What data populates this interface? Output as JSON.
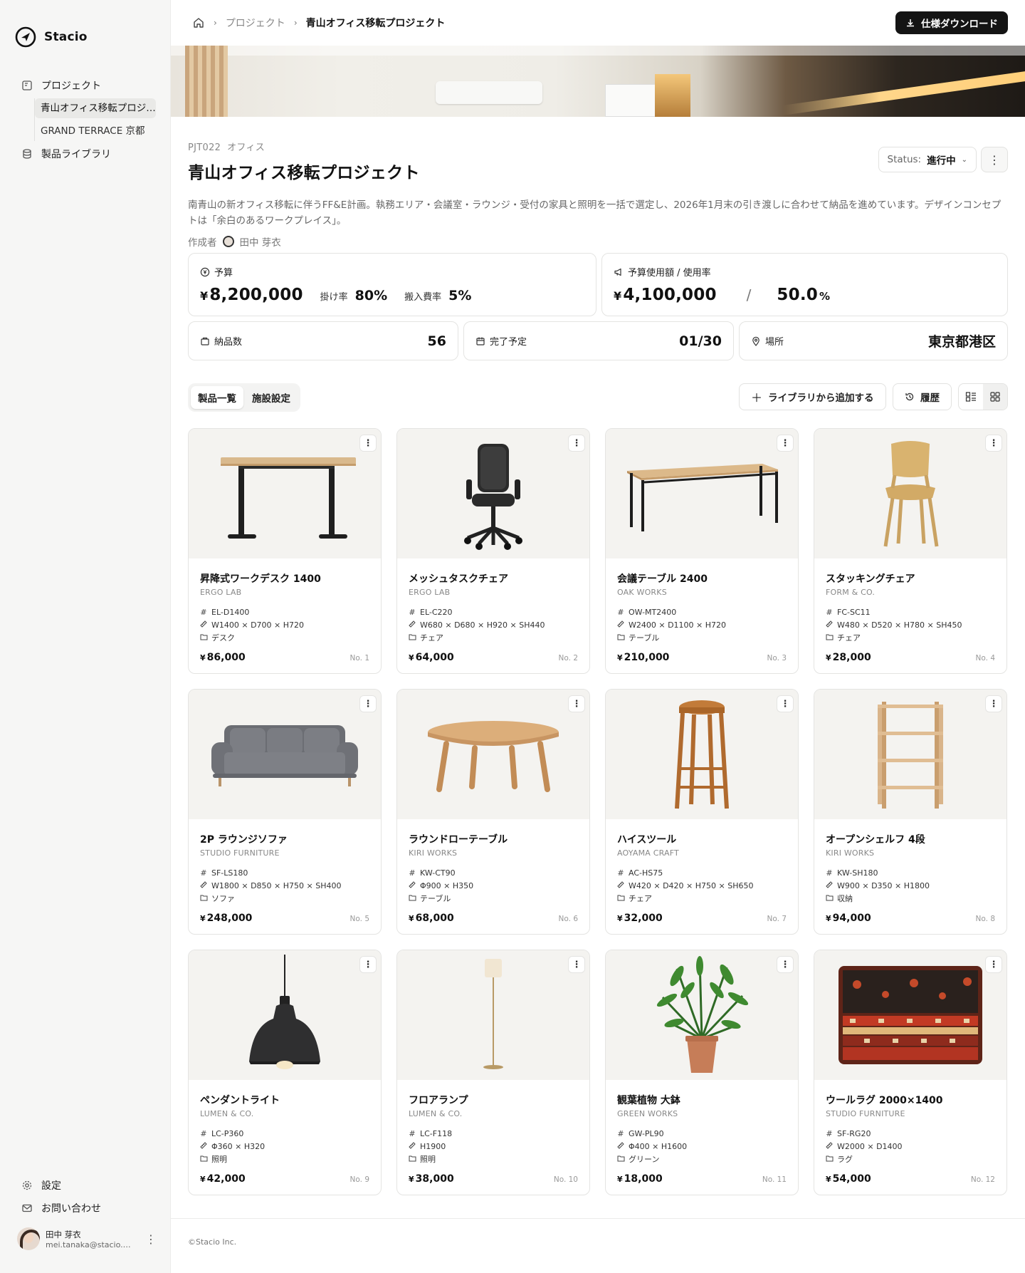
{
  "app": {
    "name": "Stacio"
  },
  "sidebar": {
    "nav": [
      {
        "label": "プロジェクト",
        "icon": "project-icon"
      },
      {
        "label": "製品ライブラリ",
        "icon": "database-icon"
      }
    ],
    "projects": [
      {
        "label": "青山オフィス移転プロジェクト",
        "active": true
      },
      {
        "label": "GRAND TERRACE 京都",
        "active": false
      }
    ],
    "bottom": [
      {
        "label": "設定",
        "icon": "gear-icon"
      },
      {
        "label": "お問い合わせ",
        "icon": "mail-icon"
      }
    ],
    "user": {
      "name": "田中 芽衣",
      "email": "mei.tanaka@stacio.co.jp"
    }
  },
  "breadcrumb": {
    "items": [
      "プロジェクト",
      "青山オフィス移転プロジェクト"
    ]
  },
  "header": {
    "download_label": "仕様ダウンロード"
  },
  "project": {
    "code": "PJT022",
    "type": "オフィス",
    "title": "青山オフィス移転プロジェクト",
    "status_label": "Status:",
    "status_value": "進行中",
    "description": "南青山の新オフィス移転に伴うFF&E計画。執務エリア・会議室・ラウンジ・受付の家具と照明を一括で選定し、2026年1月末の引き渡しに合わせて納品を進めています。デザインコンセプトは「余白のあるワークプレイス」。",
    "author_label": "作成者",
    "author_name": "田中 芽衣"
  },
  "stats": {
    "budget": {
      "label": "予算",
      "currency": "¥",
      "value": "8,200,000",
      "rate_label": "掛け率",
      "rate": "80%",
      "delivery_label": "搬入費率",
      "delivery": "5%"
    },
    "usage": {
      "label": "予算使用額 / 使用率",
      "currency": "¥",
      "value": "4,100,000",
      "separator": "/",
      "rate": "50.0",
      "unit": "%"
    },
    "items": {
      "label": "納品数",
      "value": "56"
    },
    "due": {
      "label": "完了予定",
      "value": "01/30"
    },
    "location": {
      "label": "場所",
      "value": "東京都港区"
    }
  },
  "toolbar": {
    "tabs": [
      "製品一覧",
      "施設設定"
    ],
    "add_label": "ライブラリから追加する",
    "history_label": "履歴"
  },
  "products": [
    {
      "name": "昇降式ワークデスク 1400",
      "brand": "ERGO LAB",
      "code": "EL-D1400",
      "size": "W1400 × D700 × H720",
      "category": "デスク",
      "price": "86,000",
      "no": "No. 1",
      "image": "desk"
    },
    {
      "name": "メッシュタスクチェア",
      "brand": "ERGO LAB",
      "code": "EL-C220",
      "size": "W680 × D680 × H920 × SH440",
      "category": "チェア",
      "price": "64,000",
      "no": "No. 2",
      "image": "taskchair"
    },
    {
      "name": "会議テーブル 2400",
      "brand": "OAK WORKS",
      "code": "OW-MT2400",
      "size": "W2400 × D1100 × H720",
      "category": "テーブル",
      "price": "210,000",
      "no": "No. 3",
      "image": "table"
    },
    {
      "name": "スタッキングチェア",
      "brand": "FORM & CO.",
      "code": "FC-SC11",
      "size": "W480 × D520 × H780 × SH450",
      "category": "チェア",
      "price": "28,000",
      "no": "No. 4",
      "image": "woodchair"
    },
    {
      "name": "2P ラウンジソファ",
      "brand": "STUDIO FURNITURE",
      "code": "SF-LS180",
      "size": "W1800 × D850 × H750 × SH400",
      "category": "ソファ",
      "price": "248,000",
      "no": "No. 5",
      "image": "sofa"
    },
    {
      "name": "ラウンドローテーブル",
      "brand": "KIRI WORKS",
      "code": "KW-CT90",
      "size": "Φ900 × H350",
      "category": "テーブル",
      "price": "68,000",
      "no": "No. 6",
      "image": "roundtable"
    },
    {
      "name": "ハイスツール",
      "brand": "AOYAMA CRAFT",
      "code": "AC-HS75",
      "size": "W420 × D420 × H750 × SH650",
      "category": "チェア",
      "price": "32,000",
      "no": "No. 7",
      "image": "stool"
    },
    {
      "name": "オープンシェルフ 4段",
      "brand": "KIRI WORKS",
      "code": "KW-SH180",
      "size": "W900 × D350 × H1800",
      "category": "収納",
      "price": "94,000",
      "no": "No. 8",
      "image": "shelf"
    },
    {
      "name": "ペンダントライト",
      "brand": "LUMEN & CO.",
      "code": "LC-P360",
      "size": "Φ360 × H320",
      "category": "照明",
      "price": "42,000",
      "no": "No. 9",
      "image": "pendant"
    },
    {
      "name": "フロアランプ",
      "brand": "LUMEN & CO.",
      "code": "LC-F118",
      "size": "H1900",
      "category": "照明",
      "price": "38,000",
      "no": "No. 10",
      "image": "floorlamp"
    },
    {
      "name": "観葉植物 大鉢",
      "brand": "GREEN WORKS",
      "code": "GW-PL90",
      "size": "Φ400 × H1600",
      "category": "グリーン",
      "price": "18,000",
      "no": "No. 11",
      "image": "plant"
    },
    {
      "name": "ウールラグ 2000×1400",
      "brand": "STUDIO FURNITURE",
      "code": "SF-RG20",
      "size": "W2000 × D1400",
      "category": "ラグ",
      "price": "54,000",
      "no": "No. 12",
      "image": "rug"
    }
  ],
  "footer": {
    "copyright": "©Stacio Inc."
  }
}
